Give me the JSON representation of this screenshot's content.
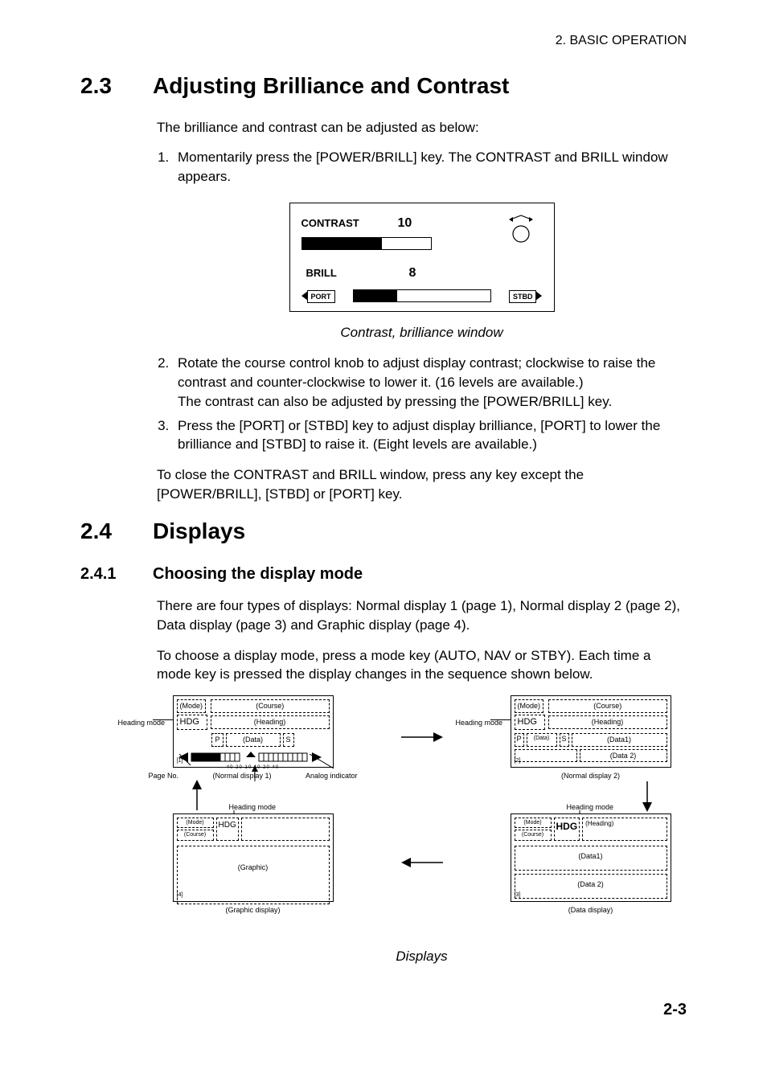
{
  "header": {
    "chapter": "2. BASIC OPERATION"
  },
  "s23": {
    "num": "2.3",
    "title": "Adjusting Brilliance and Contrast",
    "intro": "The brilliance and contrast can be adjusted as below:",
    "step1": "Momentarily press the [POWER/BRILL] key. The CONTRAST and BRILL window appears.",
    "box": {
      "contrast_label": "CONTRAST",
      "contrast_value": "10",
      "brill_label": "BRILL",
      "brill_value": "8",
      "port": "PORT",
      "stbd": "STBD"
    },
    "caption": "Contrast, brilliance window",
    "step2": "Rotate the course control knob to adjust display contrast; clockwise to raise the contrast and counter-clockwise to lower it. (16 levels are available.)",
    "step2b": "The contrast can also be adjusted by pressing the [POWER/BRILL] key.",
    "step3": "Press the [PORT] or [STBD] key to adjust display brilliance, [PORT] to lower the brilliance and [STBD] to raise it. (Eight levels are available.)",
    "close": "To close the CONTRAST and BRILL window, press any key except the [POWER/BRILL], [STBD] or [PORT] key."
  },
  "s24": {
    "num": "2.4",
    "title": "Displays",
    "sub_num": "2.4.1",
    "sub_title": "Choosing the display mode",
    "p1": "There are four types of displays: Normal display 1 (page 1), Normal display 2 (page 2), Data display (page 3) and Graphic display (page 4).",
    "p2": "To choose a display mode, press a mode key (AUTO, NAV or STBY). Each time a mode key is pressed the display changes in the sequence shown below.",
    "caption": "Displays",
    "labels": {
      "mode": "(Mode)",
      "course": "(Course)",
      "heading": "(Heading)",
      "hdg": "HDG",
      "p": "P",
      "s": "S",
      "data": "(Data)",
      "data1": "(Data1)",
      "data2": "(Data 2)",
      "graphic": "(Graphic)",
      "heading_mode": "Heading mode",
      "page_no": "Page No.",
      "analog": "Analog indicator",
      "n1": "(Normal display 1)",
      "n2": "(Normal display 2)",
      "dd": "(Data display)",
      "gd": "(Graphic display)",
      "pg1": "[1]",
      "pg2": "[2]",
      "pg3": "[3]",
      "pg4": "[4]",
      "ticks": "40  20  10          10  20 40"
    }
  },
  "footer": {
    "page": "2-3"
  }
}
